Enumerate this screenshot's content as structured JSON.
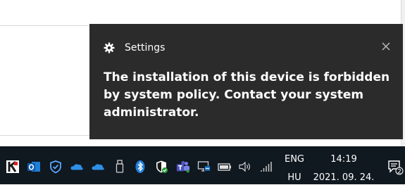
{
  "toast": {
    "app_name": "Settings",
    "message": "The installation of this device is forbidden by system policy. Contact your system administrator.",
    "icon": "gear-icon",
    "close_icon": "close-icon"
  },
  "taskbar": {
    "language_line1": "ENG",
    "language_line2": "HU",
    "time": "14:19",
    "date": "2021. 09. 24.",
    "notification_badge": "2",
    "tray_icons": [
      "k-app-icon",
      "outlook-icon",
      "defender-shield-icon",
      "onedrive-icon",
      "onedrive-icon",
      "usb-drive-icon",
      "bluetooth-icon",
      "security-shield-icon",
      "teams-icon",
      "display-network-icon",
      "battery-icon",
      "volume-icon",
      "wifi-icon"
    ]
  },
  "colors": {
    "toast_bg": "#2b2b2b",
    "taskbar_bg": "#101820",
    "text": "#ffffff",
    "accent_blue": "#1e7fd8"
  }
}
